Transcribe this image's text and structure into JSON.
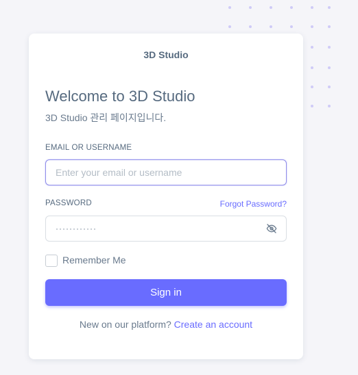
{
  "brand": {
    "name": "3D Studio"
  },
  "login": {
    "title": "Welcome to 3D Studio",
    "subtitle": "3D Studio 관리 페이지입니다.",
    "email_label": "EMAIL OR USERNAME",
    "email_placeholder": "Enter your email or username",
    "email_value": "",
    "password_label": "PASSWORD",
    "password_value": "············",
    "forgot_password": "Forgot Password?",
    "password_toggle_icon": "eye-off-icon",
    "remember_me": "Remember Me",
    "remember_checked": false,
    "sign_in": "Sign in",
    "new_user_text": "New on our platform?",
    "create_account": "Create an account"
  },
  "colors": {
    "primary": "#696cff",
    "background": "#f5f5f9",
    "text": "#566a7f",
    "dots": "#cfcbf7"
  }
}
